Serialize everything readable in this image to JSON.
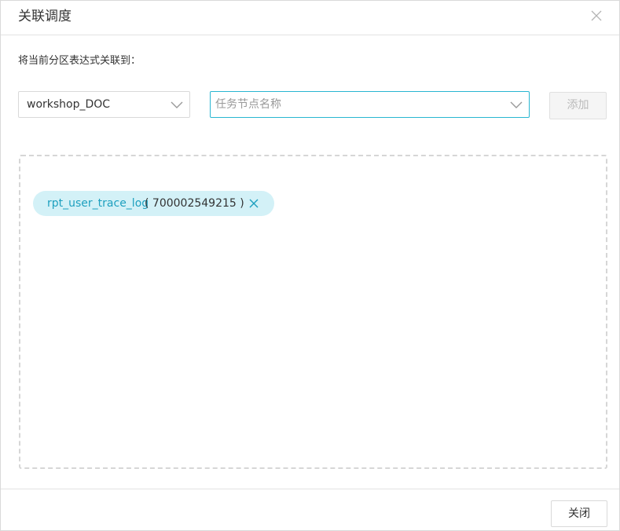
{
  "dialog": {
    "title": "关联调度",
    "description": "将当前分区表达式关联到：",
    "workspace_select": {
      "value": "workshop_DOC",
      "icon": "chevron-down-icon"
    },
    "node_input": {
      "placeholder": "任务节点名称",
      "value": "",
      "icon": "chevron-down-icon"
    },
    "add_button": {
      "label": "添加",
      "disabled": true
    },
    "tags": [
      {
        "name": "rpt_user_trace_log",
        "id": "700002549215",
        "id_display": "( 700002549215 )"
      }
    ],
    "footer": {
      "close_label": "关闭"
    }
  },
  "colors": {
    "accent": "#29b6d1",
    "tag_background": "#d3f1f7",
    "tag_text": "#1ea0bf",
    "border": "#d9d9d9"
  }
}
